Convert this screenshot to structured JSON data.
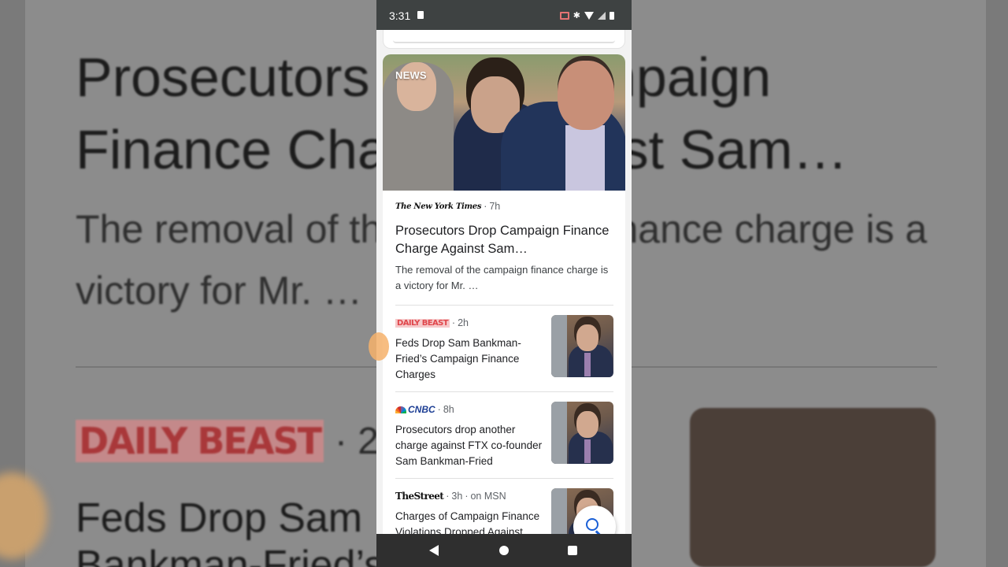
{
  "status_bar": {
    "time": "3:31"
  },
  "main_story": {
    "label": "NEWS",
    "source": "The New York Times",
    "time": "7h",
    "title": "Prosecutors Drop Campaign Finance Charge Against Sam…",
    "snippet": "The removal of the campaign finance charge is a victory for Mr. …"
  },
  "stories": [
    {
      "source": "DAILY BEAST",
      "time": "2h",
      "title": "Feds Drop Sam Bankman-Fried’s Campaign Finance Charges"
    },
    {
      "source": "CNBC",
      "time": "8h",
      "title": "Prosecutors drop another charge against FTX co-founder Sam Bankman-Fried"
    },
    {
      "source": "TheStreet",
      "time": "3h",
      "via": "on MSN",
      "title": "Charges of Campaign Finance Violations Dropped Against"
    }
  ],
  "background": {
    "title": "Prosecutors Drop Campaign Finance Charge Against Sam…",
    "snippet": "The removal of the campaign finance charge is a victory for Mr. …",
    "source": "DAILY BEAST",
    "time": "2h",
    "title2": "Feds Drop Sam Bankman-Fried’s"
  },
  "colors": {
    "accent": "#1a5fd6",
    "status_bar": "#3e4242",
    "nav_bar": "#2f2f2f"
  },
  "icons": [
    "sim-icon",
    "cast-icon",
    "bluetooth-icon",
    "wifi-icon",
    "signal-icon",
    "battery-icon",
    "search-icon",
    "back-icon",
    "home-icon",
    "recents-icon"
  ]
}
